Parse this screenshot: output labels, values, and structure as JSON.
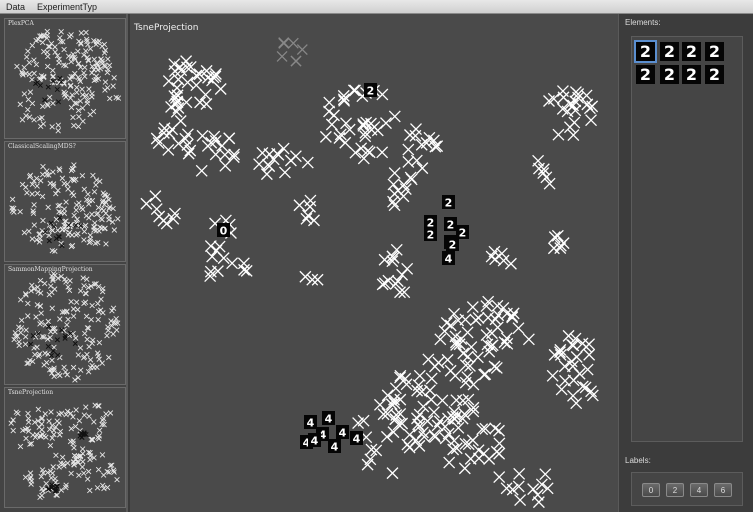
{
  "menubar": {
    "items": [
      "Data",
      "ExperimentTyp"
    ]
  },
  "sidebar": {
    "thumbnails": [
      {
        "label": "PlexPCA"
      },
      {
        "label": "ClassicalScalingMDS?"
      },
      {
        "label": "SammonMappingProjection"
      },
      {
        "label": "TsneProjection"
      }
    ]
  },
  "main": {
    "title": "TsneProjection",
    "digit_labels": [
      "2",
      "4",
      "0",
      "2",
      "2",
      "2",
      "2",
      "2",
      "2",
      "2",
      "4",
      "4",
      "4",
      "4",
      "4",
      "4",
      "4",
      "4"
    ]
  },
  "right_panel": {
    "elements_label": "Elements:",
    "element_digits": [
      "2",
      "2",
      "2",
      "2",
      "2",
      "2",
      "2",
      "2"
    ],
    "labels_label": "Labels:",
    "label_buttons": [
      "0",
      "2",
      "4",
      "6"
    ]
  },
  "colors": {
    "background": "#4a4a4a",
    "marker": "#ffffff",
    "selection": "#5b8fd0"
  }
}
